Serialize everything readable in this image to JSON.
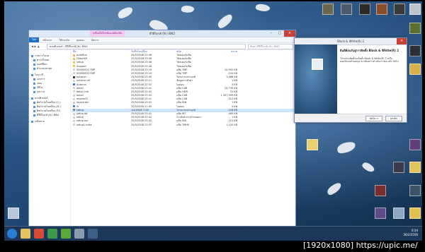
{
  "explorer": {
    "tab_tag": "เครื่องมือไดรฟ์แอปพลิเคชัน",
    "title": "ดีวีดีไดรฟ์ (N:) BW2",
    "ribbon": [
      "ไฟล์",
      "หน้าแรก",
      "ใช้ร่วมกัน",
      "มุมมอง",
      "จัดการ"
    ],
    "path": "คอมพิวเตอร์ › ดีวีดีไดรฟ์ (N:) BW2",
    "search_placeholder": "ค้นหา ดีวีดีไดรฟ์ (N:) BW2",
    "nav": [
      {
        "label": "รายการโปรด",
        "group": true
      },
      {
        "label": "ดาวน์โหลด",
        "group": false
      },
      {
        "label": "เดสก์ท็อป",
        "group": false
      },
      {
        "label": "ตำแหน่งล่าสุด",
        "group": false
      },
      {
        "label": "ไลบรารี",
        "group": true
      },
      {
        "label": "เอกสาร",
        "group": false
      },
      {
        "label": "เพลง",
        "group": false
      },
      {
        "label": "วิดีโอ",
        "group": false
      },
      {
        "label": "รูปภาพ",
        "group": false
      },
      {
        "label": "คอมพิวเตอร์",
        "group": true
      },
      {
        "label": "ดิสก์ภายในเครื่อง (C:)",
        "group": false
      },
      {
        "label": "ดิสก์ภายในเครื่อง (D:)",
        "group": false
      },
      {
        "label": "ดิสก์ภายในเครื่อง (E:)",
        "group": false
      },
      {
        "label": "ดีวีดีไดรฟ์ (N:) BW2",
        "group": false
      },
      {
        "label": "เครือข่าย",
        "group": true
      }
    ],
    "headers": [
      "ชื่อ",
      "วันที่ปรับเปลี่ยน",
      "ชนิด",
      "ขนาด"
    ],
    "files": [
      {
        "name": "AutoRun",
        "date": "25/5/2548 23:46",
        "type": "โฟลเดอร์แฟ้ม",
        "size": "",
        "color": "#e8c15a"
      },
      {
        "name": "DirectX9",
        "date": "25/5/2548 23:06",
        "type": "โฟลเดอร์แฟ้ม",
        "size": "",
        "color": "#e8c15a"
      },
      {
        "name": "setup",
        "date": "25/5/2548 23:46",
        "type": "โฟลเดอร์แฟ้ม",
        "size": "",
        "color": "#e8c15a"
      },
      {
        "name": "Support",
        "date": "25/5/2548 23:46",
        "type": "โฟลเดอร์แฟ้ม",
        "size": "",
        "color": "#e8c15a"
      },
      {
        "name": "00000001.TMP",
        "date": "25/5/2548 23:19",
        "type": "แฟ้ม TMP",
        "size": "20,992 KB",
        "color": "#d0d4da"
      },
      {
        "name": "00000002.TMP",
        "date": "25/5/2548 23:19",
        "type": "แฟ้ม TMP",
        "size": "210 KB",
        "color": "#d0d4da"
      },
      {
        "name": "autorun",
        "date": "25/5/2548 23:45",
        "type": "โปรแกรมประยุกต์",
        "size": "1,468 KB",
        "color": "#3a3a3a"
      },
      {
        "name": "autorun.inf",
        "date": "25/5/2548 23:11",
        "type": "ข้อมูลการตั้งค่า",
        "size": "1 KB",
        "color": "#d0d4da"
      },
      {
        "name": "Autorun",
        "date": "18/5/2548 22:52",
        "type": "ไอคอน",
        "size": "3 KB",
        "color": "#4a7bc0"
      },
      {
        "name": "data1",
        "date": "25/5/2548 23:41",
        "type": "แฟ้ม CAB",
        "size": "25,730 KB",
        "color": "#d0d4da"
      },
      {
        "name": "data1.hdr",
        "date": "25/5/2548 23:41",
        "type": "แฟ้ม HDR",
        "size": "31 KB",
        "color": "#d0d4da"
      },
      {
        "name": "data2",
        "date": "25/5/2548 23:41",
        "type": "แฟ้ม CAB",
        "size": "1,307,599 KB",
        "color": "#d0d4da"
      },
      {
        "name": "engine32",
        "date": "25/5/2548 23:41",
        "type": "แฟ้ม CAB",
        "size": "512 KB",
        "color": "#d0d4da"
      },
      {
        "name": "layout.bin",
        "date": "25/5/2548 23:41",
        "type": "แฟ้ม BIN",
        "size": "1 KB",
        "color": "#d0d4da"
      },
      {
        "name": "lh",
        "date": "20/5/2548 21:45",
        "type": "ไอคอน",
        "size": "3 KB",
        "color": "#4a7bc0"
      },
      {
        "name": "setup",
        "date": "1/4/2546 7:28",
        "type": "โปรแกรมประยุกต์",
        "size": "118 KB",
        "color": "#7d8795"
      },
      {
        "name": "setup.ibt",
        "date": "25/5/2548 23:41",
        "type": "แฟ้ม IBT",
        "size": "465 KB",
        "color": "#d0d4da"
      },
      {
        "name": "setup",
        "date": "25/5/2548 23:41",
        "type": "การตั้งค่าการกำหนดค่า",
        "size": "1 KB",
        "color": "#d0d4da"
      },
      {
        "name": "setup.inx",
        "date": "25/5/2548 23:22",
        "type": "แฟ้ม INX",
        "size": "221 KB",
        "color": "#d0d4da"
      },
      {
        "name": "setup1.hdkk",
        "date": "25/5/2548 23:37",
        "type": "แฟ้ม TMHE",
        "size": "1,120 KB",
        "color": "#d0d4da"
      }
    ]
  },
  "dialog": {
    "title": "Black & White(R) 2",
    "heading": "ยินดีต้อนรับสู่การติดตั้ง Black & White(R) 2",
    "body": "โปรแกรมติดตั้งจะติดตั้ง Black & White(R) 2 ลงในคอมพิวเตอร์ของคุณ หากต้องการดำเนินการต่อ คลิก ถัดไป",
    "next_label": "ถัดไป >",
    "cancel_label": "ยกเลิก"
  },
  "desktop_icons": [
    {
      "label": "",
      "color": "#6b6650"
    },
    {
      "label": "",
      "color": "#4d5a6a"
    },
    {
      "label": "",
      "color": "#2a2a2a"
    },
    {
      "label": "",
      "color": "#8b4d2a"
    },
    {
      "label": "",
      "color": "#3a3a3a"
    },
    {
      "label": "",
      "color": "#c0c5cc"
    },
    {
      "label": "",
      "color": "#5a6f2d"
    },
    {
      "label": "",
      "color": "#2b2f38"
    },
    {
      "label": "",
      "color": "#d8b04a"
    },
    {
      "label": "",
      "color": "#e8d070"
    },
    {
      "label": "",
      "color": "#5e3f7a"
    },
    {
      "label": "",
      "color": "#3d3a4e"
    },
    {
      "label": "",
      "color": "#e3c35b"
    },
    {
      "label": "",
      "color": "#7a2f2f"
    },
    {
      "label": "",
      "color": "#3f5366"
    },
    {
      "label": "",
      "color": "#5f4b88"
    },
    {
      "label": "",
      "color": "#8fa7c0"
    },
    {
      "label": "",
      "color": "#e0c050"
    }
  ],
  "taskbar": {
    "clock_time": "0:24",
    "clock_date": "26/2/2556",
    "buttons": [
      {
        "name": "ie-icon",
        "color": "#2a7fd4"
      },
      {
        "name": "folder-icon",
        "color": "#e3c15e"
      },
      {
        "name": "chrome-icon",
        "color": "#d84a3a"
      },
      {
        "name": "store-icon",
        "color": "#3d9a4a"
      },
      {
        "name": "utorrent-icon",
        "color": "#5aa83a"
      },
      {
        "name": "setup-icon",
        "color": "#8a9aad"
      },
      {
        "name": "game-icon",
        "color": "#3f5f86"
      }
    ]
  },
  "watermark": "[1920x1080] https://upic.me/"
}
